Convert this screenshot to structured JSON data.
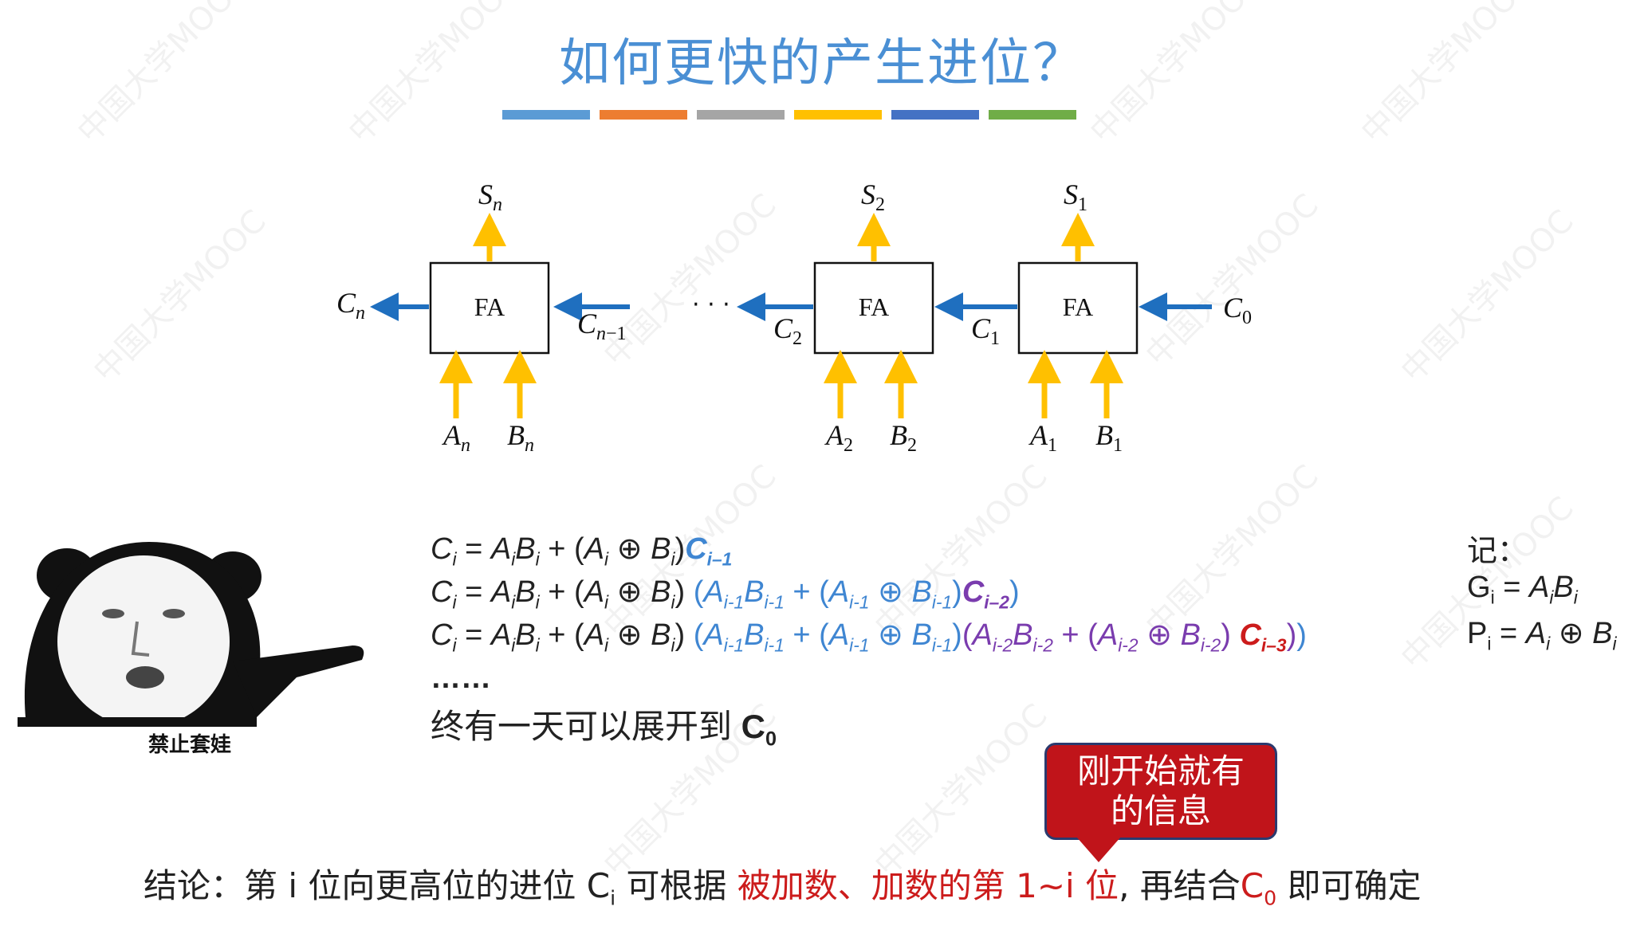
{
  "title": "如何更快的产生进位？",
  "title_bar_colors": [
    "#5b9bd5",
    "#ed7d31",
    "#a5a5a5",
    "#ffc000",
    "#4472c4",
    "#70ad47"
  ],
  "diagram": {
    "block_label": "FA",
    "dots": "· · ·",
    "colors": {
      "sum_arrow": "#ffc000",
      "carry_arrow": "#1f6fbf"
    }
  },
  "equations": {
    "line1": {
      "base": "Ci = AiBi + (Ai ⊕ Bi)",
      "tail": "Ci–1"
    },
    "line2": {
      "base": "Ci = AiBi + (Ai ⊕ Bi)",
      "blue": "(Ai-1Bi-1 + (Ai-1 ⊕ Bi-1)",
      "tail": "Ci–2",
      "close": ")"
    },
    "line3": {
      "base": "Ci = AiBi + (Ai ⊕ Bi)",
      "blue": "(Ai-1Bi-1 + (Ai-1 ⊕ Bi-1)",
      "purple": "(Ai-2Bi-2 + (Ai-2 ⊕ Bi-2)",
      "tail": "Ci–3",
      "close": "))"
    },
    "ellipsis": "……",
    "expand_prefix": "终有一天可以展开到 ",
    "expand_c0": "C0"
  },
  "note": {
    "heading": "记：",
    "g": "Gi = AiBi",
    "p": "Pi = Ai ⊕ Bi"
  },
  "callout": {
    "line1": "刚开始就有",
    "line2": "的信息"
  },
  "conclusion": {
    "part1": "结论：第 i 位向更高位的进位 C",
    "sub_i": "i",
    "part2": " 可根据 ",
    "red1": "被加数、加数的第 1~i 位",
    "part3": ", 再结合",
    "red_c": "C",
    "red_sub": "0",
    "part4": " 即可确定"
  },
  "meme_caption": "禁止套娃",
  "watermark": "中国大学MOOC"
}
